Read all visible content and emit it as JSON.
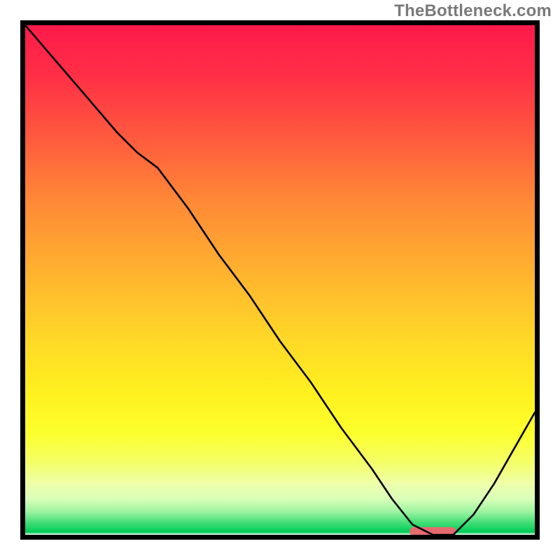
{
  "watermark": "TheBottleneck.com",
  "chart_data": {
    "type": "line",
    "title": "",
    "xlabel": "",
    "ylabel": "",
    "xlim": [
      0,
      100
    ],
    "ylim": [
      0,
      100
    ],
    "grid": false,
    "legend": false,
    "series": [
      {
        "name": "bottleneck-curve",
        "x": [
          0,
          6,
          12,
          18,
          22,
          26,
          32,
          38,
          44,
          50,
          56,
          62,
          68,
          72,
          76,
          80,
          84,
          88,
          92,
          96,
          100
        ],
        "y": [
          100,
          93,
          86,
          79,
          75,
          72,
          64,
          55,
          47,
          38,
          30,
          21,
          13,
          7,
          2,
          0,
          0,
          4,
          10,
          17,
          24
        ]
      }
    ],
    "flat_region": {
      "x_start": 76,
      "x_end": 84,
      "y": 0
    },
    "gradient_bands": [
      {
        "stop": 0.0,
        "color": "#ff1a4b"
      },
      {
        "stop": 0.1,
        "color": "#ff2f46"
      },
      {
        "stop": 0.22,
        "color": "#ff5a3e"
      },
      {
        "stop": 0.35,
        "color": "#ff8a36"
      },
      {
        "stop": 0.5,
        "color": "#ffb72e"
      },
      {
        "stop": 0.62,
        "color": "#ffd927"
      },
      {
        "stop": 0.72,
        "color": "#fff01f"
      },
      {
        "stop": 0.8,
        "color": "#fcff2c"
      },
      {
        "stop": 0.86,
        "color": "#f4ff6a"
      },
      {
        "stop": 0.9,
        "color": "#efffab"
      },
      {
        "stop": 0.93,
        "color": "#d8ffb8"
      },
      {
        "stop": 0.955,
        "color": "#9cf3a0"
      },
      {
        "stop": 0.975,
        "color": "#46df78"
      },
      {
        "stop": 0.995,
        "color": "#00cc55"
      },
      {
        "stop": 1.0,
        "color": "#ffffff"
      }
    ],
    "background_colors": {
      "top": "#ff1a4b",
      "mid": "#ffe01f",
      "bottom_green": "#00cc55"
    }
  }
}
